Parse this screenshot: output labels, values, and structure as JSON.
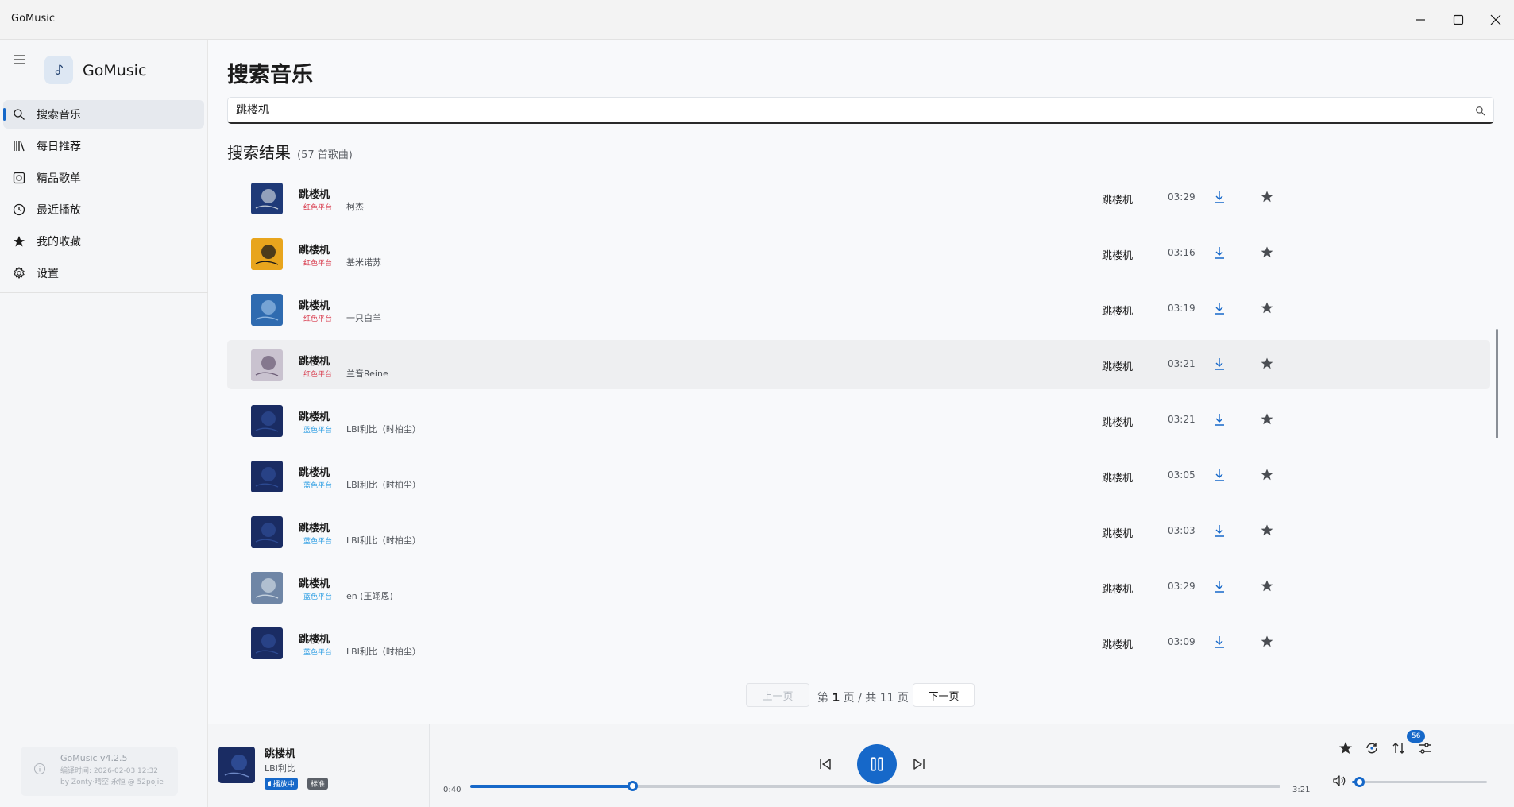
{
  "window": {
    "title": "GoMusic"
  },
  "sidebar": {
    "brand": "GoMusic",
    "items": [
      {
        "label": "搜索音乐",
        "icon": "search-icon",
        "active": true
      },
      {
        "label": "每日推荐",
        "icon": "library-icon",
        "active": false
      },
      {
        "label": "精品歌单",
        "icon": "album-icon",
        "active": false
      },
      {
        "label": "最近播放",
        "icon": "clock-icon",
        "active": false
      },
      {
        "label": "我的收藏",
        "icon": "star-icon",
        "active": false
      },
      {
        "label": "设置",
        "icon": "gear-icon",
        "active": false
      }
    ],
    "version": {
      "title": "GoMusic v4.2.5",
      "build": "编译时间: 2026-02-03 12:32",
      "credit": "by Zonty·晴空·永恒 @ 52pojie"
    }
  },
  "main": {
    "page_title": "搜索音乐",
    "search": {
      "value": "跳楼机",
      "placeholder": ""
    },
    "results_title": "搜索结果",
    "results_count": "(57 首歌曲)"
  },
  "songs": [
    {
      "title": "跳楼机",
      "platform": "红色平台",
      "platform_color": "red",
      "artist": "柯杰",
      "album": "跳楼机",
      "duration": "03:29",
      "cover": [
        "#1f3a78",
        "#b9c3d2"
      ]
    },
    {
      "title": "跳楼机",
      "platform": "红色平台",
      "platform_color": "red",
      "artist": "基米诺苏",
      "album": "跳楼机",
      "duration": "03:16",
      "cover": [
        "#e8a51d",
        "#1a1a1a"
      ]
    },
    {
      "title": "跳楼机",
      "platform": "红色平台",
      "platform_color": "red",
      "artist": "一只白羊",
      "album": "跳楼机",
      "duration": "03:19",
      "cover": [
        "#2f6bb0",
        "#8fb6e0"
      ]
    },
    {
      "title": "跳楼机",
      "platform": "红色平台",
      "platform_color": "red",
      "artist": "兰音Reine",
      "album": "跳楼机",
      "duration": "03:21",
      "cover": [
        "#c9c2cf",
        "#6e5f78"
      ]
    },
    {
      "title": "跳楼机",
      "platform": "蓝色平台",
      "platform_color": "blue",
      "artist": "LBI利比（时柏尘）",
      "album": "跳楼机",
      "duration": "03:21",
      "cover": [
        "#1a2c63",
        "#2d4a92"
      ]
    },
    {
      "title": "跳楼机",
      "platform": "蓝色平台",
      "platform_color": "blue",
      "artist": "LBI利比（时柏尘）",
      "album": "跳楼机",
      "duration": "03:05",
      "cover": [
        "#1a2c63",
        "#2d4a92"
      ]
    },
    {
      "title": "跳楼机",
      "platform": "蓝色平台",
      "platform_color": "blue",
      "artist": "LBI利比（时柏尘）",
      "album": "跳楼机",
      "duration": "03:03",
      "cover": [
        "#1a2c63",
        "#2d4a92"
      ]
    },
    {
      "title": "跳楼机",
      "platform": "蓝色平台",
      "platform_color": "blue",
      "artist": "en (王翊恩)",
      "album": "跳楼机",
      "duration": "03:29",
      "cover": [
        "#6f86a6",
        "#c6d2de"
      ]
    },
    {
      "title": "跳楼机",
      "platform": "蓝色平台",
      "platform_color": "blue",
      "artist": "LBI利比（时柏尘）",
      "album": "跳楼机",
      "duration": "03:09",
      "cover": [
        "#1a2c63",
        "#2d4a92"
      ]
    }
  ],
  "active_row": 3,
  "pagination": {
    "prev_label": "上一页",
    "next_label": "下一页",
    "page_prefix": "第 ",
    "current": "1",
    "page_suffix": " 页",
    "total_text": " / 共 11 页"
  },
  "player": {
    "title": "跳楼机",
    "artist": "LBI利比",
    "playing_badge": "播放中",
    "quality_badge": "标准",
    "time_current": "0:40",
    "time_total": "3:21",
    "progress_fraction": 0.2,
    "queue_count": "56",
    "volume_fraction": 0.05
  },
  "colors": {
    "accent": "#1668c9",
    "platform_red": "#d8394b",
    "platform_blue": "#2a9de3"
  }
}
